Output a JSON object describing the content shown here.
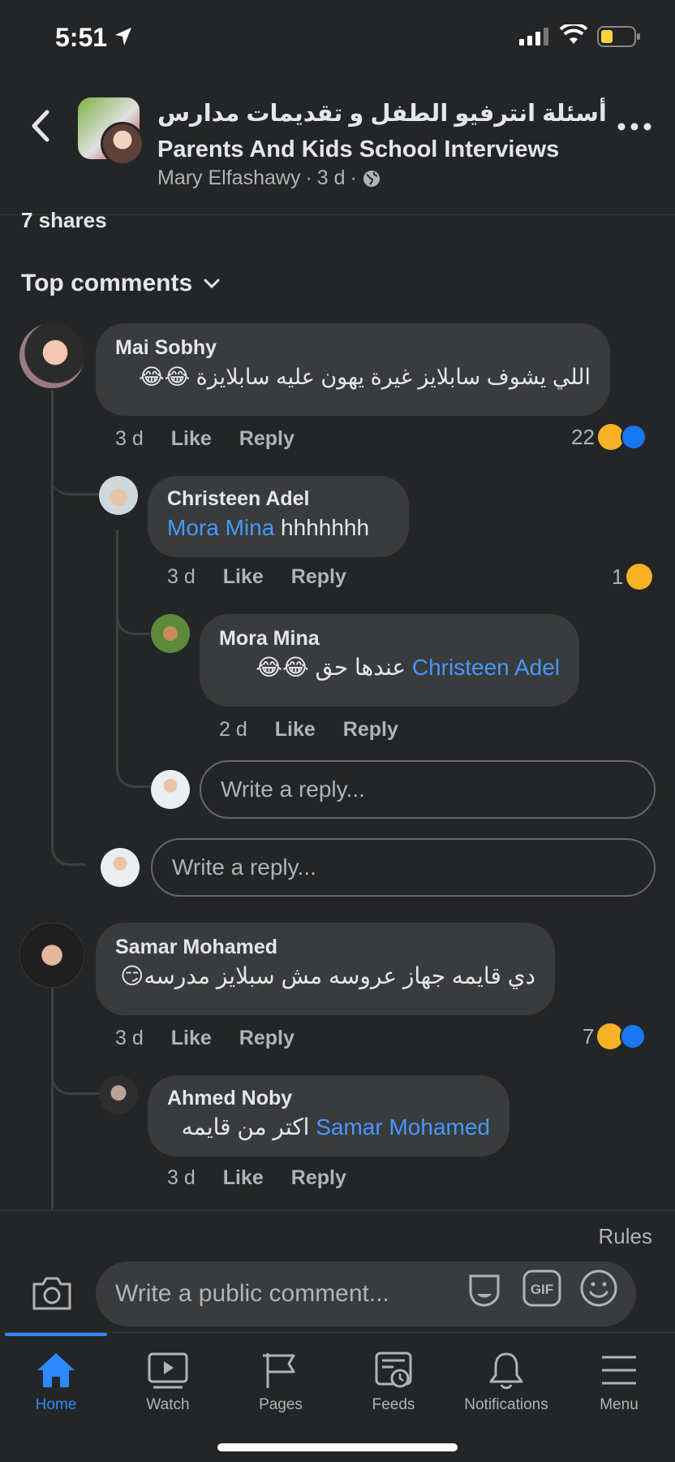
{
  "status": {
    "time": "5:51"
  },
  "header": {
    "title_ar": "أسئلة انترفيو الطفل و تقديمات مدارس",
    "title_en": "Parents And Kids School Interviews",
    "author": "Mary Elfashawy",
    "time": "3 d",
    "separator": "·"
  },
  "post": {
    "shares": "7 shares",
    "sort_label": "Top comments"
  },
  "comments": [
    {
      "name": "Mai Sobhy",
      "text": "اللي يشوف سابلايز غيرة يهون عليه سابلايزة 😂😂",
      "time": "3 d",
      "like": "Like",
      "reply": "Reply",
      "reaction_count": "22"
    },
    {
      "name": "Christeen Adel",
      "mention": "Mora Mina",
      "text": " hhhhhhh",
      "time": "3 d",
      "like": "Like",
      "reply": "Reply",
      "reaction_count": "1"
    },
    {
      "name": "Mora Mina",
      "mention": "Christeen Adel",
      "text": "عندها حق 😂😂",
      "time": "2 d",
      "like": "Like",
      "reply": "Reply"
    },
    {
      "name": "Samar Mohamed",
      "text": "دي قايمه جهاز عروسه مش سبلايز مدرسه😏",
      "time": "3 d",
      "like": "Like",
      "reply": "Reply",
      "reaction_count": "7"
    },
    {
      "name": "Ahmed Noby",
      "mention": "Samar Mohamed",
      "text": "اكتر من قايمه",
      "time": "3 d",
      "like": "Like",
      "reply": "Reply"
    }
  ],
  "reply_placeholder": "Write a reply...",
  "composer": {
    "rules": "Rules",
    "placeholder": "Write a public comment...",
    "gif": "GIF"
  },
  "tabs": [
    {
      "label": "Home",
      "icon": "home-icon"
    },
    {
      "label": "Watch",
      "icon": "watch-icon"
    },
    {
      "label": "Pages",
      "icon": "flag-icon"
    },
    {
      "label": "Feeds",
      "icon": "feeds-icon"
    },
    {
      "label": "Notifications",
      "icon": "bell-icon"
    },
    {
      "label": "Menu",
      "icon": "menu-icon"
    }
  ],
  "colors": {
    "background": "#242526",
    "bubble": "#3a3b3c",
    "accent": "#2d88ff",
    "mention": "#4599ff"
  }
}
